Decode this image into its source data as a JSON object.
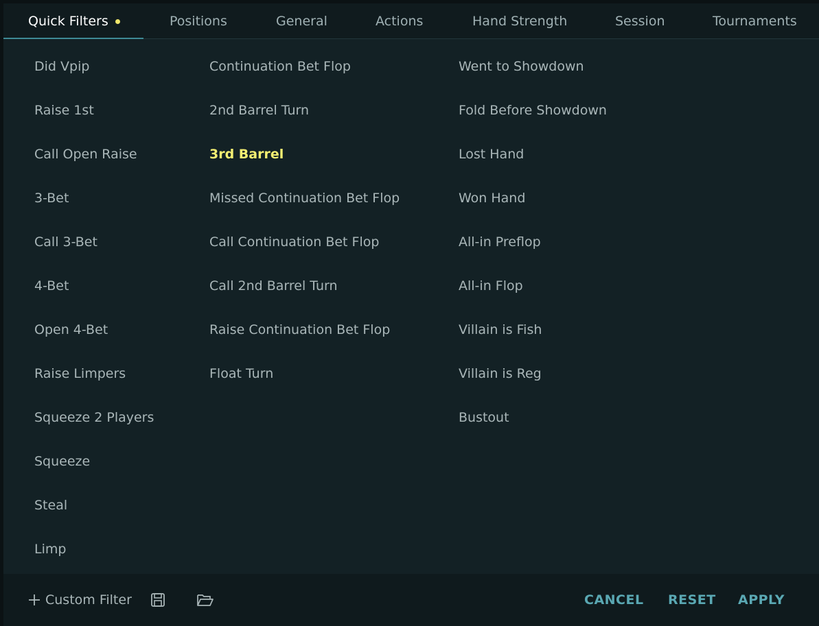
{
  "tabs": [
    {
      "label": "Quick Filters"
    },
    {
      "label": "Positions"
    },
    {
      "label": "General"
    },
    {
      "label": "Actions"
    },
    {
      "label": "Hand Strength"
    },
    {
      "label": "Session"
    },
    {
      "label": "Tournaments"
    }
  ],
  "columns": {
    "col1": [
      "Did Vpip",
      "Raise 1st",
      "Call Open Raise",
      "3-Bet",
      "Call 3-Bet",
      "4-Bet",
      "Open 4-Bet",
      "Raise Limpers",
      "Squeeze 2 Players",
      "Squeeze",
      "Steal",
      "Limp"
    ],
    "col2": [
      "Continuation Bet Flop",
      "2nd Barrel Turn",
      "3rd Barrel",
      "Missed Continuation Bet Flop",
      "Call Continuation Bet Flop",
      "Call 2nd Barrel Turn",
      "Raise Continuation Bet Flop",
      "Float Turn"
    ],
    "col3": [
      "Went to Showdown",
      "Fold Before Showdown",
      "Lost Hand",
      "Won Hand",
      "All-in Preflop",
      "All-in Flop",
      "Villain is Fish",
      "Villain is Reg",
      "Bustout"
    ]
  },
  "footer": {
    "custom_filter": "Custom Filter",
    "cancel": "CANCEL",
    "reset": "RESET",
    "apply": "APPLY"
  },
  "colors": {
    "accent": "#5aa8b3",
    "highlight": "#f3ee72",
    "active_dot": "#f0e66a"
  }
}
